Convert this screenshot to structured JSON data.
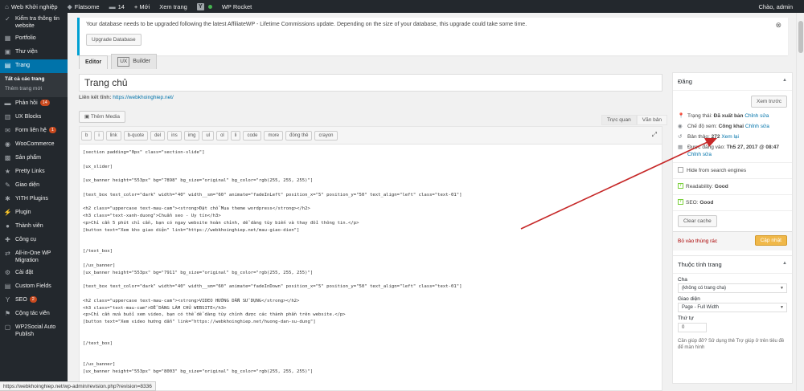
{
  "adminbar": {
    "site": "Web Khởi nghiệp",
    "theme": "Flatsome",
    "comments": "14",
    "new": "+ Mới",
    "view": "Xem trang",
    "yoast": "Y",
    "rocket": "WP Rocket",
    "greeting": "Chào, admin"
  },
  "sidebar": {
    "items": [
      {
        "icon": "check-icon",
        "label": "Kiểm tra thông tin website"
      },
      {
        "icon": "portfolio-icon",
        "label": "Portfolio"
      },
      {
        "icon": "media-icon",
        "label": "Thư viện"
      },
      {
        "icon": "page-icon",
        "label": "Trang"
      },
      {
        "icon": "comment-icon",
        "label": "Phản hồi",
        "badge": "14"
      },
      {
        "icon": "blocks-icon",
        "label": "UX Blocks"
      },
      {
        "icon": "form-icon",
        "label": "Form liên hệ",
        "badge": "1"
      },
      {
        "icon": "woo-icon",
        "label": "WooCommerce"
      },
      {
        "icon": "product-icon",
        "label": "Sản phẩm"
      },
      {
        "icon": "link-icon",
        "label": "Pretty Links"
      },
      {
        "icon": "appearance-icon",
        "label": "Giao diện"
      },
      {
        "icon": "plugin-icon",
        "label": "YITH Plugins"
      },
      {
        "icon": "plugin-icon",
        "label": "Plugin"
      },
      {
        "icon": "user-icon",
        "label": "Thành viên"
      },
      {
        "icon": "tools-icon",
        "label": "Công cụ"
      },
      {
        "icon": "migration-icon",
        "label": "All-in-One WP Migration"
      },
      {
        "icon": "settings-icon",
        "label": "Cài đặt"
      },
      {
        "icon": "fields-icon",
        "label": "Custom Fields"
      },
      {
        "icon": "seo-icon",
        "label": "SEO",
        "badge": "2"
      },
      {
        "icon": "affiliate-icon",
        "label": "Cộng tác viên"
      },
      {
        "icon": "social-icon",
        "label": "WP2Social Auto Publish"
      }
    ],
    "submenu": [
      "Tất cả các trang",
      "Thêm trang mới"
    ]
  },
  "notice": {
    "text": "Your database needs to be upgraded following the latest AffiliateWP - Lifetime Commissions update. Depending on the size of your database, this upgrade could take some time.",
    "button": "Upgrade Database",
    "close": "⊗"
  },
  "tabs": {
    "editor": "Editor",
    "ux": "UX",
    "builder": "Builder"
  },
  "post": {
    "title": "Trang chủ",
    "permalink_label": "Liên kết tĩnh:",
    "permalink": "https://webkhoinghiep.net/"
  },
  "toolbar": {
    "media": "Thêm Media",
    "visual": "Trực quan",
    "text": "Văn bản",
    "quicktags": [
      "b",
      "i",
      "link",
      "b-quote",
      "del",
      "ins",
      "img",
      "ul",
      "ol",
      "li",
      "code",
      "more",
      "đóng thẻ",
      "crayon"
    ]
  },
  "code": "[section padding=\"0px\" class=\"section-slide\"]\n\n[ux_slider]\n\n[ux_banner height=\"553px\" bg=\"7898\" bg_size=\"original\" bg_color=\"rgb(255, 255, 255)\"]\n\n[text_box text_color=\"dark\" width=\"40\" width__sm=\"60\" animate=\"fadeInLeft\" position_x=\"5\" position_y=\"50\" text_align=\"left\" class=\"text-01\"]\n\n<h2 class=\"uppercase text-mau-cam\"><strong>Đặt chỗ Mua theme wordpress</strong></h2>\n<h3 class=\"text-xanh-duong\">Chuẩn seo - Uy tín</h3>\n<p>Chỉ cần 5 phút chỉ cần, bạn có ngay website hoàn chỉnh, dễ dàng tùy biến và thay đổi thông tin.</p>\n[button text=\"Xem kho giao diện\" link=\"https://webkhoinghiep.net/mau-giao-dien\"]\n\n\n[/text_box]\n\n[/ux_banner]\n[ux_banner height=\"553px\" bg=\"7911\" bg_size=\"original\" bg_color=\"rgb(255, 255, 255)\"]\n\n[text_box text_color=\"dark\" width=\"40\" width__sm=\"60\" animate=\"fadeInDown\" position_x=\"5\" position_y=\"50\" text_align=\"left\" class=\"text-01\"]\n\n<h2 class=\"uppercase text-mau-cam\"><strong>VIDEO HƯỚNG DẪN SỬ DỤNG</strong></h2>\n<h3 class=\"text-mau-cam\">DỄ DÀNG LÀM CHỦ WEBSITE</h3>\n<p>Chỉ cần nửa buổi xem video, bạn có thể dễ dàng tùy chỉnh được các thành phần trên website.</p>\n[button text=\"Xem video hướng dẫn\" link=\"https://webkhoinghiep.net/huong-dan-su-dung\"]\n\n\n[/text_box]\n\n\n[/ux_banner]\n[ux_banner height=\"553px\" bg=\"8003\" bg_size=\"original\" bg_color=\"rgb(255, 255, 255)\"]",
  "publish": {
    "title": "Đăng",
    "preview": "Xem trước",
    "status_label": "Trạng thái:",
    "status_value": "Đã xuất bản",
    "status_edit": "Chỉnh sửa",
    "visibility_label": "Chế độ xem:",
    "visibility_value": "Công khai",
    "visibility_edit": "Chỉnh sửa",
    "revisions_label": "Bản thảo:",
    "revisions_value": "272",
    "revisions_link": "Xem lại",
    "published_label": "Được đăng vào:",
    "published_value": "Th5 27, 2017 @ 08:47",
    "published_edit": "Chỉnh sửa",
    "hide_search": "Hide from search engines",
    "readability_label": "Readability:",
    "readability_value": "Good",
    "seo_label": "SEO:",
    "seo_value": "Good",
    "clear_cache": "Clear cache",
    "trash": "Bỏ vào thùng rác",
    "update": "Cập nhật"
  },
  "attributes": {
    "title": "Thuộc tính trang",
    "parent_label": "Cha",
    "parent_value": "(không có trang cha)",
    "template_label": "Giao diện",
    "template_value": "Page - Full Width",
    "order_label": "Thứ tự",
    "order_value": "0",
    "help": "Cần giúp đỡ? Sử dụng thẻ Trợ giúp ở trên tiêu đề để màn hình"
  },
  "statusbar": "https://webkhoinghiep.net/wp-admin/revision.php?revision=8336",
  "colors": {
    "accent": "#0073aa",
    "adminbar": "#23282d",
    "arrow": "#c62828",
    "publish": "#f0b849"
  }
}
